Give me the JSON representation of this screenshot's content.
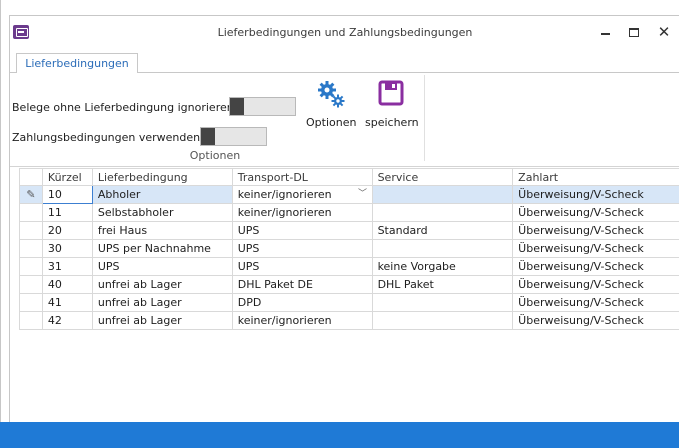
{
  "window": {
    "title": "Lieferbedingungen und Zahlungsbedingungen",
    "minimize_label": "",
    "maximize_label": "",
    "close_label": "✕"
  },
  "tabs": [
    {
      "label": "Lieferbedingungen"
    }
  ],
  "ribbon": {
    "option1_label": "Belege ohne Lieferbedingung ignorieren",
    "option2_label": "Zahlungsbedingungen verwenden",
    "option1_on": false,
    "option2_on": false,
    "optionen_button": "Optionen",
    "speichern_button": "speichern",
    "group_caption": "Optionen"
  },
  "grid": {
    "columns": [
      "Kürzel",
      "Lieferbedingung",
      "Transport-DL",
      "Service",
      "Zahlart"
    ],
    "rows": [
      [
        "10",
        "Abholer",
        "keiner/ignorieren",
        "",
        "Überweisung/V-Scheck"
      ],
      [
        "11",
        "Selbstabholer",
        "keiner/ignorieren",
        "",
        "Überweisung/V-Scheck"
      ],
      [
        "20",
        "frei Haus",
        "UPS",
        "Standard",
        "Überweisung/V-Scheck"
      ],
      [
        "30",
        "UPS per Nachnahme",
        "UPS",
        "",
        "Überweisung/V-Scheck"
      ],
      [
        "31",
        "UPS",
        "UPS",
        "keine Vorgabe",
        "Überweisung/V-Scheck"
      ],
      [
        "40",
        "unfrei ab Lager",
        "DHL Paket DE",
        "DHL Paket",
        "Überweisung/V-Scheck"
      ],
      [
        "41",
        "unfrei ab Lager",
        "DPD",
        "",
        "Überweisung/V-Scheck"
      ],
      [
        "42",
        "unfrei ab Lager",
        "keiner/ignorieren",
        "",
        "Überweisung/V-Scheck"
      ]
    ],
    "selected_row": 0,
    "edit_indicator": "✎"
  },
  "colors": {
    "accent": "#2b6cb8",
    "statusbar": "#1f7ad6",
    "selection": "#d7e6f7",
    "toggle_knob": "#444444",
    "gear": "#2a78c8",
    "save": "#8a2ea0"
  },
  "icons": {
    "optionen": "gears-icon",
    "speichern": "save-floppy-icon"
  }
}
